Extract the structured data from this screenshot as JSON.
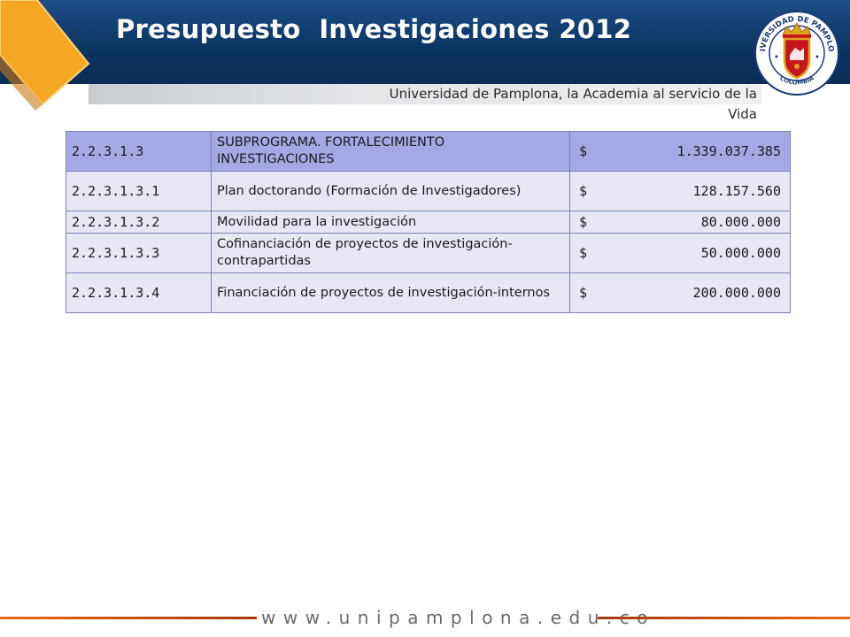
{
  "header": {
    "title": "Presupuesto  Investigaciones 2012",
    "tagline": "Universidad de Pamplona, la Academia al servicio de la Vida",
    "seal_top_text": "UNIVERSIDAD DE PAMPLONA",
    "seal_bottom_text": "COLOMBIA"
  },
  "colors": {
    "header_blue": "#0b3360",
    "accent_orange": "#f5a623",
    "table_header_fill": "#a6a8e6",
    "table_row_fill": "#e8e8f5"
  },
  "table": {
    "rows": [
      {
        "code": "2.2.3.1.3",
        "description": "SUBPROGRAMA. FORTALECIMIENTO INVESTIGACIONES",
        "currency": "$",
        "amount": "1.339.037.385"
      },
      {
        "code": "2.2.3.1.3.1",
        "description": "Plan  doctorando (Formación de Investigadores)",
        "currency": "$",
        "amount": "128.157.560"
      },
      {
        "code": "2.2.3.1.3.2",
        "description": "Movilidad para la investigación",
        "currency": "$",
        "amount": "80.000.000"
      },
      {
        "code": "2.2.3.1.3.3",
        "description": "Cofinanciación de proyectos de investigación-contrapartidas",
        "currency": "$",
        "amount": "50.000.000"
      },
      {
        "code": "2.2.3.1.3.4",
        "description": "Financiación de proyectos de investigación-internos",
        "currency": "$",
        "amount": "200.000.000"
      }
    ]
  },
  "footer": {
    "url": "www.unipamplona.edu.co"
  }
}
